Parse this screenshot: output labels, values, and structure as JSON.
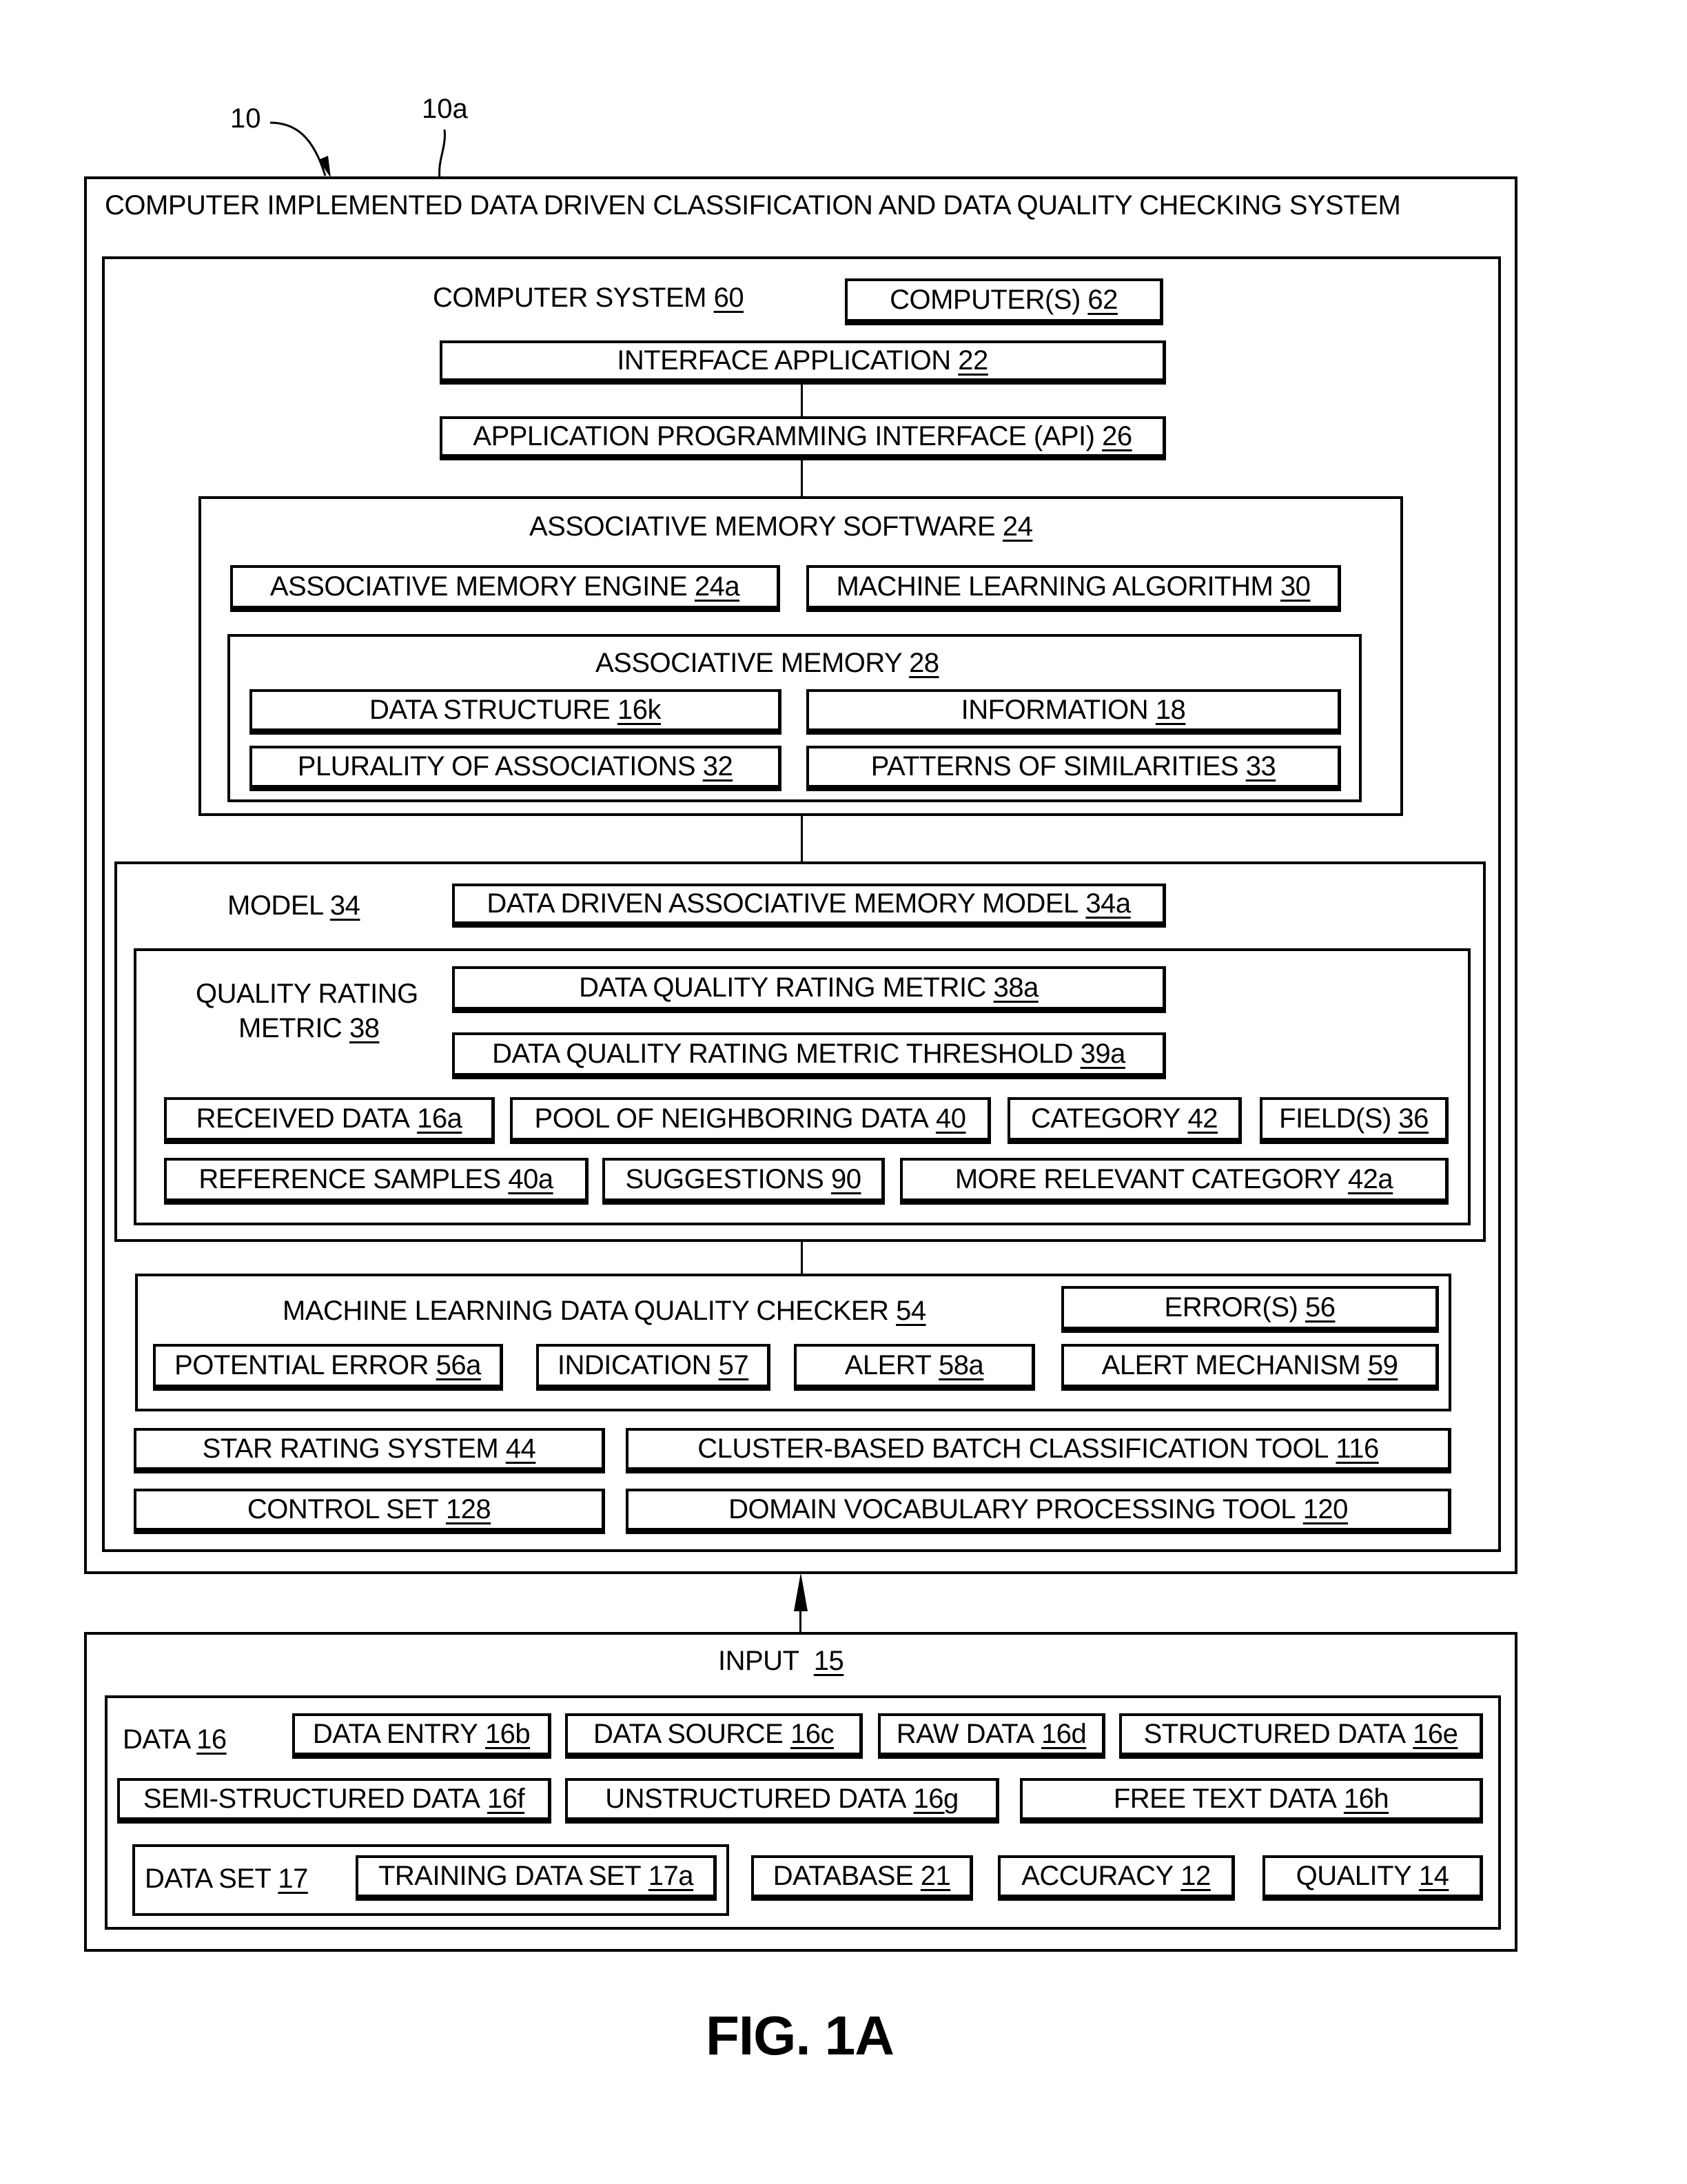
{
  "callouts": {
    "system_ref": "10",
    "box_ref": "10a"
  },
  "system": {
    "title": "COMPUTER IMPLEMENTED DATA DRIVEN CLASSIFICATION AND DATA QUALITY CHECKING SYSTEM",
    "computer_system": {
      "label": "COMPUTER SYSTEM",
      "ref": "60"
    },
    "computers": {
      "label": "COMPUTER(S)",
      "ref": "62"
    },
    "interface_application": {
      "label": "INTERFACE APPLICATION",
      "ref": "22"
    },
    "api": {
      "label": "APPLICATION PROGRAMMING INTERFACE (API)",
      "ref": "26"
    },
    "associative_memory_software": {
      "label": "ASSOCIATIVE MEMORY SOFTWARE",
      "ref": "24",
      "engine": {
        "label": "ASSOCIATIVE MEMORY ENGINE",
        "ref": "24a"
      },
      "ml_algorithm": {
        "label": "MACHINE LEARNING ALGORITHM",
        "ref": "30"
      },
      "associative_memory": {
        "label": "ASSOCIATIVE MEMORY",
        "ref": "28",
        "items": [
          {
            "label": "DATA STRUCTURE",
            "ref": "16k"
          },
          {
            "label": "INFORMATION",
            "ref": "18"
          },
          {
            "label": "PLURALITY OF ASSOCIATIONS",
            "ref": "32"
          },
          {
            "label": "PATTERNS OF SIMILARITIES",
            "ref": "33"
          }
        ]
      }
    },
    "model": {
      "label": "MODEL",
      "ref": "34",
      "dd_model": {
        "label": "DATA DRIVEN ASSOCIATIVE MEMORY MODEL",
        "ref": "34a"
      },
      "quality_rating_metric": {
        "label_line1": "QUALITY RATING",
        "label_line2": "METRIC",
        "ref": "38",
        "metric": {
          "label": "DATA QUALITY RATING METRIC",
          "ref": "38a"
        },
        "threshold": {
          "label": "DATA QUALITY RATING METRIC THRESHOLD",
          "ref": "39a"
        },
        "row1": [
          {
            "label": "RECEIVED DATA",
            "ref": "16a"
          },
          {
            "label": "POOL OF NEIGHBORING DATA",
            "ref": "40"
          },
          {
            "label": "CATEGORY",
            "ref": "42"
          },
          {
            "label": "FIELD(S)",
            "ref": "36"
          }
        ],
        "row2": [
          {
            "label": "REFERENCE SAMPLES",
            "ref": "40a"
          },
          {
            "label": "SUGGESTIONS",
            "ref": "90"
          },
          {
            "label": "MORE RELEVANT CATEGORY",
            "ref": "42a"
          }
        ]
      }
    },
    "checker": {
      "label": "MACHINE LEARNING DATA QUALITY CHECKER",
      "ref": "54",
      "errors": {
        "label": "ERROR(S)",
        "ref": "56"
      },
      "items": [
        {
          "label": "POTENTIAL ERROR",
          "ref": "56a"
        },
        {
          "label": "INDICATION",
          "ref": "57"
        },
        {
          "label": "ALERT",
          "ref": "58a"
        },
        {
          "label": "ALERT MECHANISM",
          "ref": "59"
        }
      ]
    },
    "tools": [
      {
        "label": "STAR RATING SYSTEM",
        "ref": "44"
      },
      {
        "label": "CLUSTER-BASED BATCH CLASSIFICATION TOOL",
        "ref": "116"
      },
      {
        "label": "CONTROL SET",
        "ref": "128"
      },
      {
        "label": "DOMAIN VOCABULARY PROCESSING TOOL",
        "ref": "120"
      }
    ]
  },
  "input": {
    "label": "INPUT",
    "ref": "15",
    "data": {
      "label": "DATA",
      "ref": "16",
      "row1": [
        {
          "label": "DATA ENTRY",
          "ref": "16b"
        },
        {
          "label": "DATA SOURCE",
          "ref": "16c"
        },
        {
          "label": "RAW DATA",
          "ref": "16d"
        },
        {
          "label": "STRUCTURED DATA",
          "ref": "16e"
        }
      ],
      "row2": [
        {
          "label": "SEMI-STRUCTURED DATA",
          "ref": "16f"
        },
        {
          "label": "UNSTRUCTURED DATA",
          "ref": "16g"
        },
        {
          "label": "FREE TEXT DATA",
          "ref": "16h"
        }
      ],
      "data_set": {
        "label": "DATA SET",
        "ref": "17",
        "training": {
          "label": "TRAINING DATA SET",
          "ref": "17a"
        }
      },
      "row3": [
        {
          "label": "DATABASE",
          "ref": "21"
        },
        {
          "label": "ACCURACY",
          "ref": "12"
        },
        {
          "label": "QUALITY",
          "ref": "14"
        }
      ]
    }
  },
  "figure_label": "FIG. 1A"
}
